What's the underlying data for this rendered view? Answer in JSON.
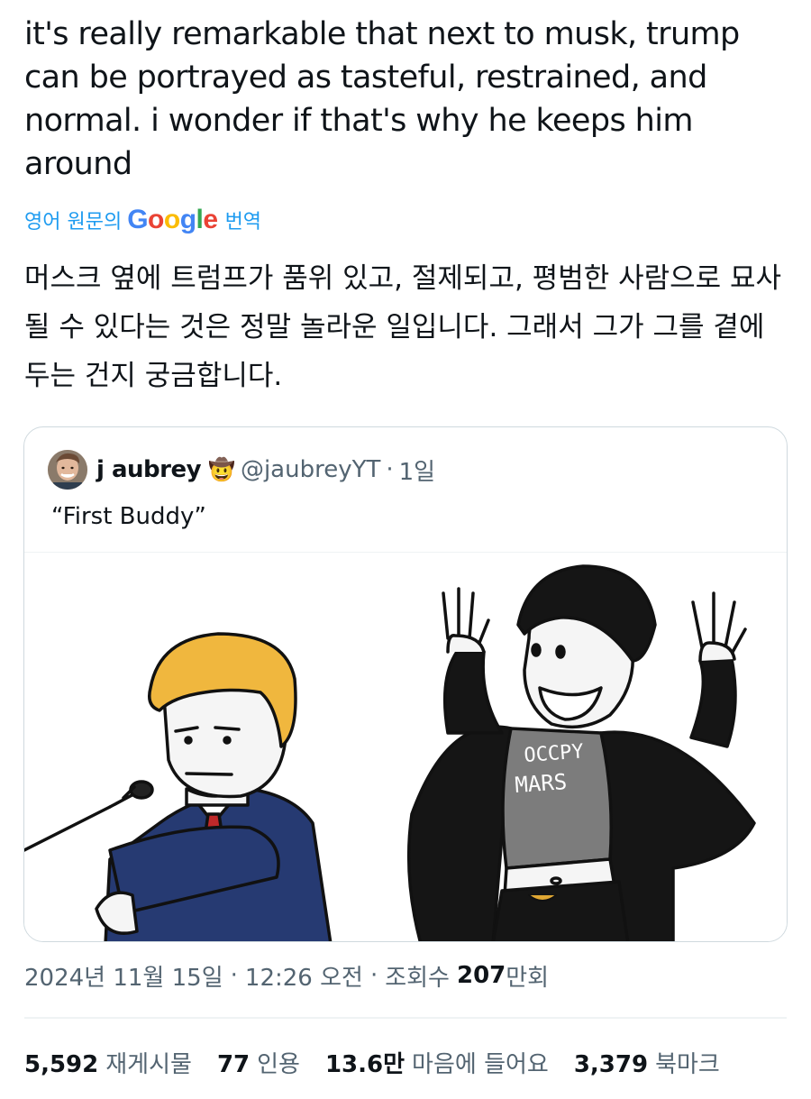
{
  "tweet": {
    "text": "it's really remarkable that next to musk, trump can be portrayed as tasteful, restrained, and normal. i wonder if that's why he keeps him around",
    "translate": {
      "prefix": "영어 원문의",
      "brand_letters": [
        "G",
        "o",
        "o",
        "g",
        "l",
        "e"
      ],
      "link": "번역"
    },
    "translated_text": "머스크 옆에 트럼프가 품위 있고, 절제되고, 평범한 사람으로 묘사될 수 있다는 것은 정말 놀라운 일입니다. 그래서 그가 그를 곁에 두는 건지 궁금합니다."
  },
  "quote": {
    "name": "j aubrey",
    "emoji": "🤠",
    "handle": "@jaubreyYT",
    "dot": "·",
    "time": "1일",
    "text": "“First Buddy”",
    "image_text": {
      "shirt_line1": "OCCPY",
      "shirt_line2": "MARS"
    }
  },
  "meta": {
    "date": "2024년 11월 15일",
    "sep1": "·",
    "time": "12:26 오전",
    "sep2": "·",
    "views_label": "조회수",
    "views_num": "207",
    "views_unit": "만회"
  },
  "stats": [
    {
      "num": "5,592",
      "label": "재게시물"
    },
    {
      "num": "77",
      "label": "인용"
    },
    {
      "num": "13.6만",
      "label": "마음에 들어요"
    },
    {
      "num": "3,379",
      "label": "북마크"
    }
  ],
  "colors": {
    "text": "#0f1419",
    "muted": "#536471",
    "link": "#1d9bf0",
    "border": "#cfd9de"
  }
}
